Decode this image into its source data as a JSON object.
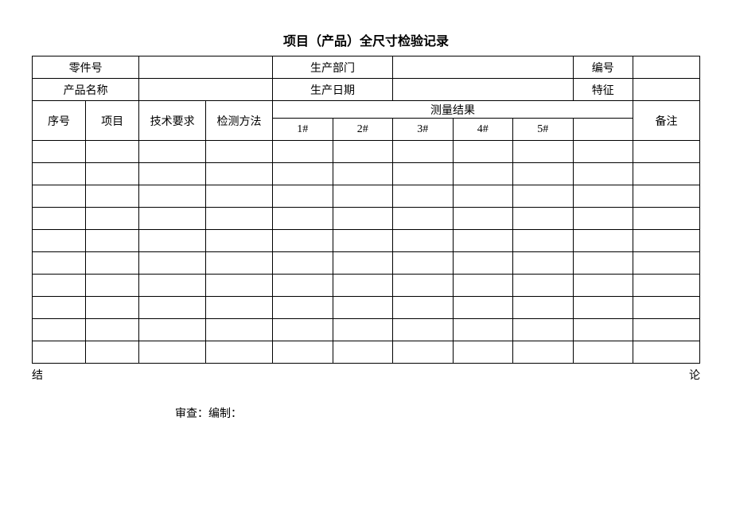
{
  "title": "项目（产品）全尺寸检验记录",
  "header": {
    "part_no_label": "零件号",
    "dept_label": "生产部门",
    "code_label": "编号",
    "product_name_label": "产品名称",
    "prod_date_label": "生产日期",
    "feature_label": "特征"
  },
  "columns": {
    "seq": "序号",
    "item": "项目",
    "tech_req": "技术要求",
    "method": "检测方法",
    "result_group": "测量结果",
    "r1": "1#",
    "r2": "2#",
    "r3": "3#",
    "r4": "4#",
    "r5": "5#",
    "remark": "备注"
  },
  "footer": {
    "left": "结",
    "right": "论",
    "sign": "审查：编制："
  },
  "chart_data": {
    "type": "table",
    "title": "项目（产品）全尺寸检验记录",
    "info_fields": [
      {
        "label": "零件号",
        "value": ""
      },
      {
        "label": "生产部门",
        "value": ""
      },
      {
        "label": "编号",
        "value": ""
      },
      {
        "label": "产品名称",
        "value": ""
      },
      {
        "label": "生产日期",
        "value": ""
      },
      {
        "label": "特征",
        "value": ""
      }
    ],
    "columns": [
      "序号",
      "项目",
      "技术要求",
      "检测方法",
      "1#",
      "2#",
      "3#",
      "4#",
      "5#",
      "备注"
    ],
    "measurement_group_label": "测量结果",
    "rows": [
      [
        "",
        "",
        "",
        "",
        "",
        "",
        "",
        "",
        "",
        ""
      ],
      [
        "",
        "",
        "",
        "",
        "",
        "",
        "",
        "",
        "",
        ""
      ],
      [
        "",
        "",
        "",
        "",
        "",
        "",
        "",
        "",
        "",
        ""
      ],
      [
        "",
        "",
        "",
        "",
        "",
        "",
        "",
        "",
        "",
        ""
      ],
      [
        "",
        "",
        "",
        "",
        "",
        "",
        "",
        "",
        "",
        ""
      ],
      [
        "",
        "",
        "",
        "",
        "",
        "",
        "",
        "",
        "",
        ""
      ],
      [
        "",
        "",
        "",
        "",
        "",
        "",
        "",
        "",
        "",
        ""
      ],
      [
        "",
        "",
        "",
        "",
        "",
        "",
        "",
        "",
        "",
        ""
      ],
      [
        "",
        "",
        "",
        "",
        "",
        "",
        "",
        "",
        "",
        ""
      ],
      [
        "",
        "",
        "",
        "",
        "",
        "",
        "",
        "",
        "",
        ""
      ]
    ],
    "footer": {
      "left": "结",
      "right": "论",
      "sign_line": "审查：编制："
    }
  }
}
